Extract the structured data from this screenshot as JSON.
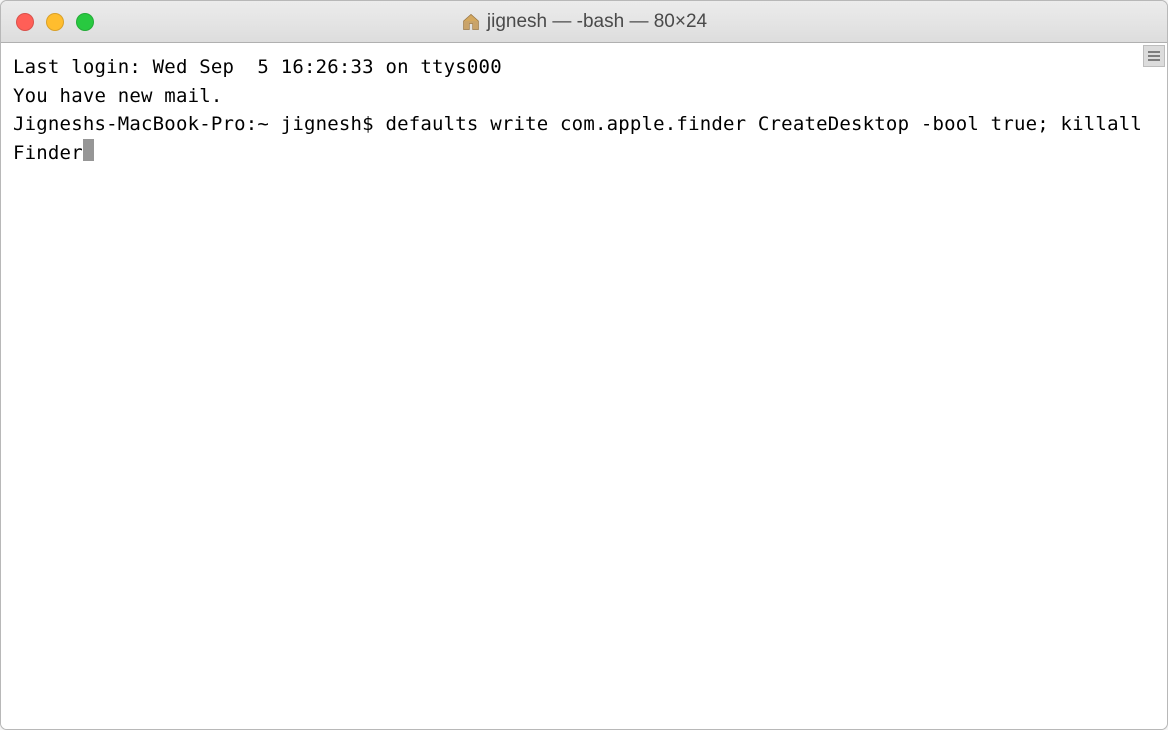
{
  "window": {
    "title": "jignesh — -bash — 80×24"
  },
  "terminal": {
    "line1": "Last login: Wed Sep  5 16:26:33 on ttys000",
    "line2": "You have new mail.",
    "prompt": "Jigneshs-MacBook-Pro:~ jignesh$ ",
    "command": "defaults write com.apple.finder CreateDesktop -bool true; killall Finder"
  }
}
